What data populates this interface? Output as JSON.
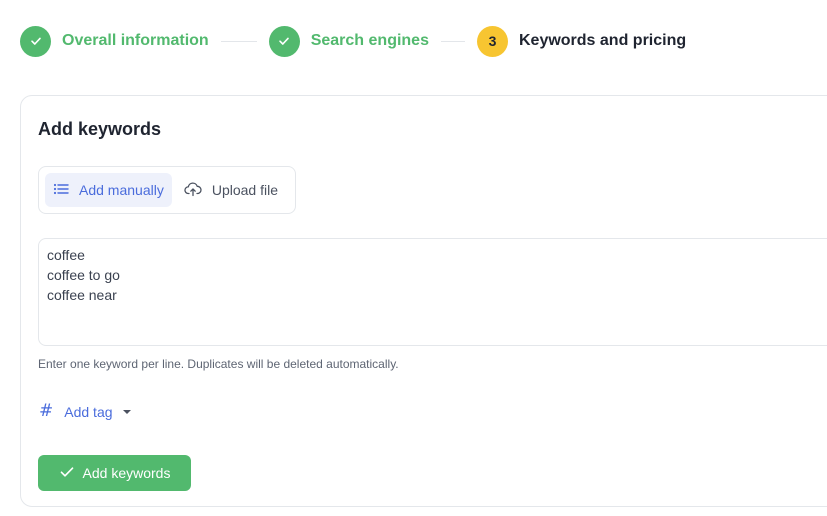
{
  "stepper": {
    "steps": [
      {
        "label": "Overall information",
        "state": "done",
        "icon": "check-icon"
      },
      {
        "label": "Search engines",
        "state": "done",
        "icon": "check-icon"
      },
      {
        "label": "Keywords and pricing",
        "state": "active",
        "number": "3"
      }
    ]
  },
  "card": {
    "title": "Add keywords",
    "tabs": [
      {
        "label": "Add manually",
        "icon": "list-icon",
        "active": true
      },
      {
        "label": "Upload file",
        "icon": "cloud-upload-icon",
        "active": false
      }
    ],
    "keywords_text": "coffee\ncoffee to go\ncoffee near",
    "hint": "Enter one keyword per line. Duplicates will be deleted automatically.",
    "add_tag_label": "Add tag",
    "submit_label": "Add keywords"
  },
  "colors": {
    "success": "#52b96e",
    "active_step": "#f7c531",
    "link": "#4a6cdc",
    "tab_active_bg": "#eef1fb"
  }
}
